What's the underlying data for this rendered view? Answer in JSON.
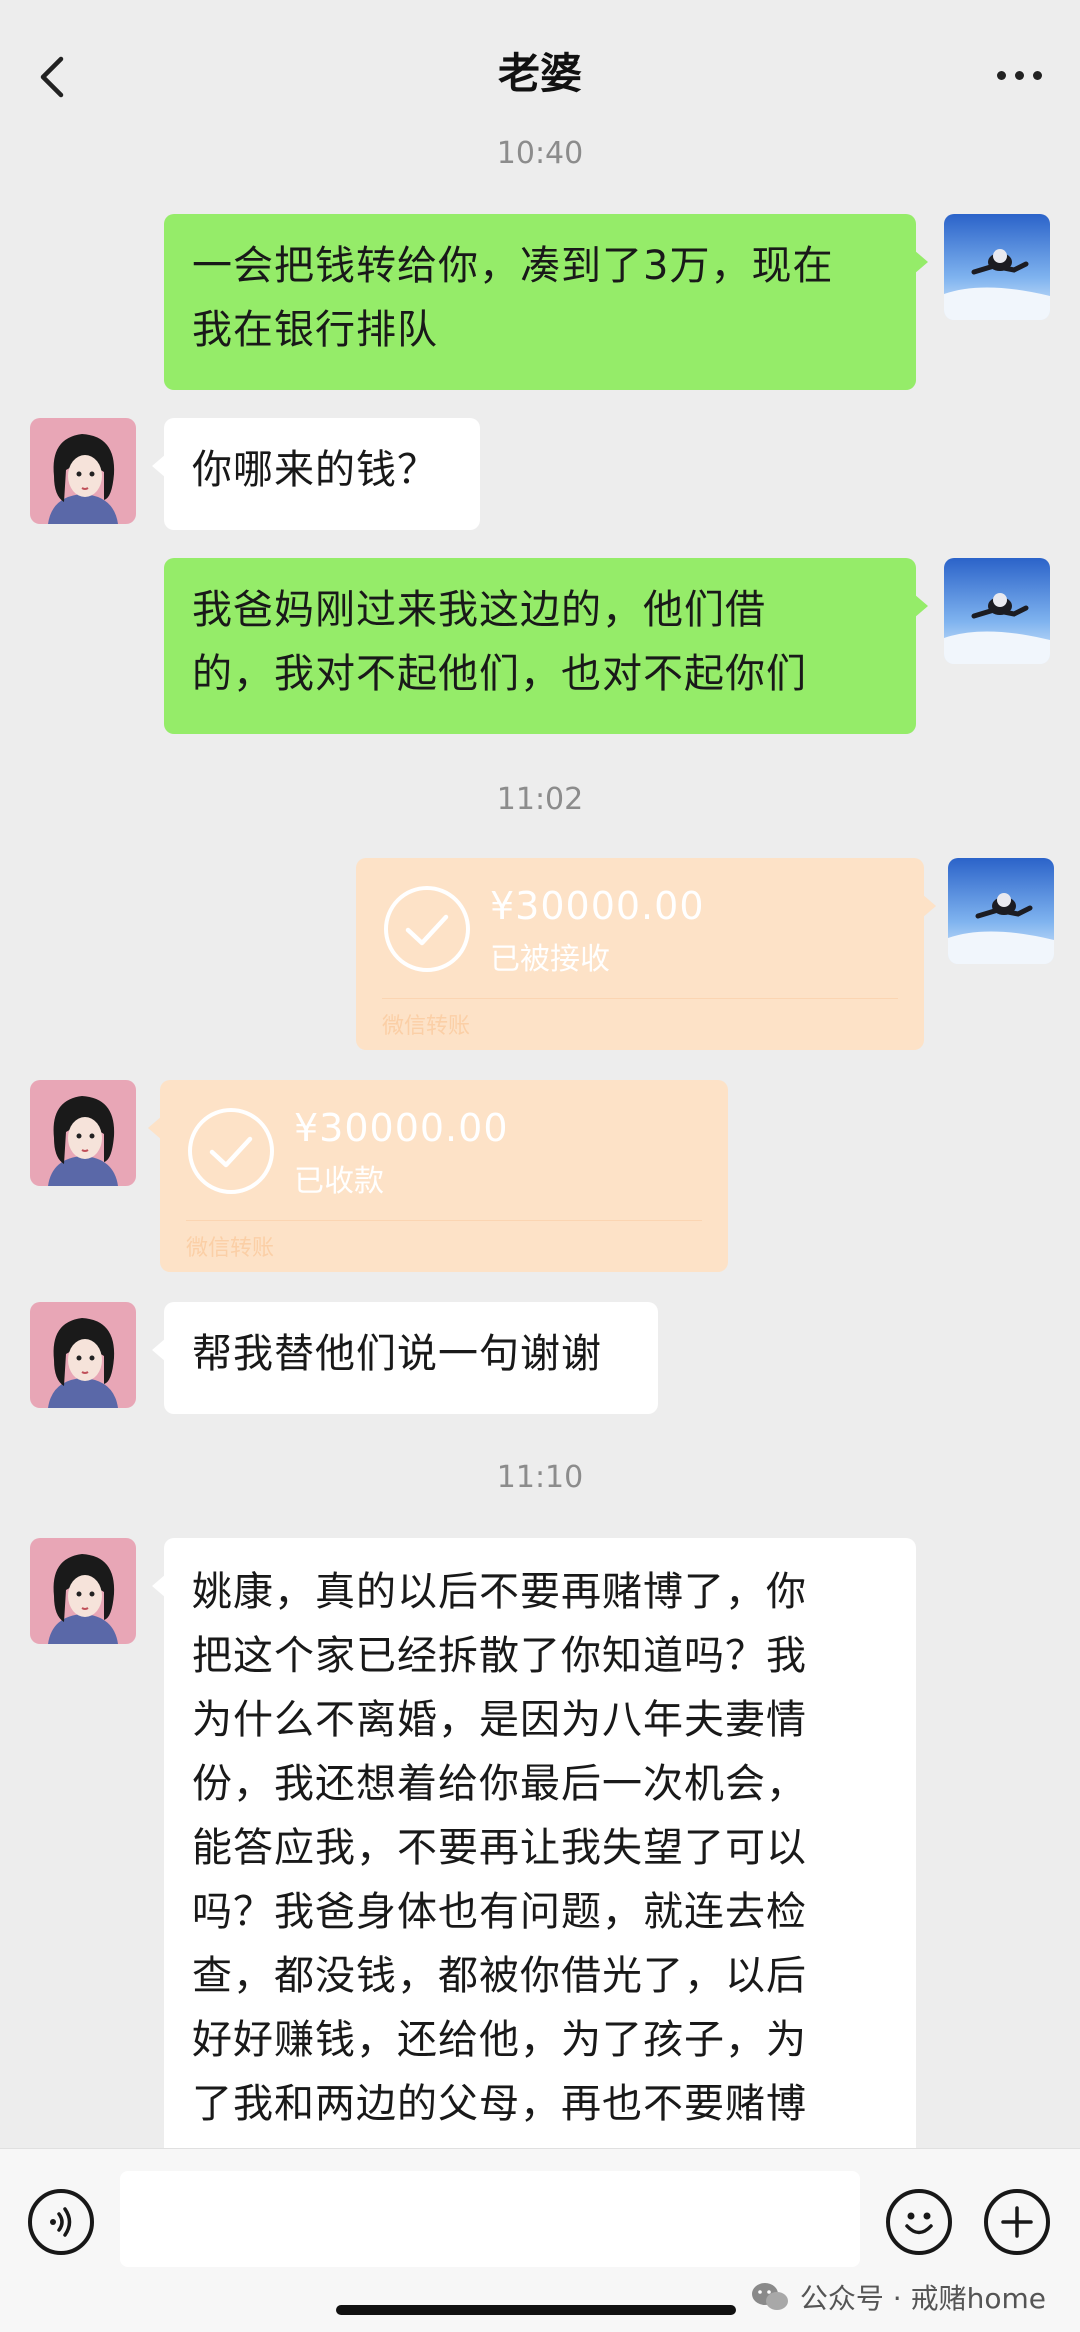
{
  "header": {
    "title": "老婆"
  },
  "messages": {
    "m1": {
      "time": "10:40",
      "text_line1": "一会把钱转给你，凑到了3万，现在",
      "text_line2": "我在银行排队"
    },
    "m2": {
      "text": "你哪来的钱？"
    },
    "m3": {
      "text_line1": "我爸妈刚过来我这边的，他们借",
      "text_line2": "的，我对不起他们，也对不起你们"
    },
    "m4": {
      "time": "11:02",
      "amount": "¥30000.00",
      "status": "已被接收",
      "footer": "微信转账"
    },
    "m5": {
      "amount": "¥30000.00",
      "status": "已收款",
      "footer": "微信转账"
    },
    "m6": {
      "text": "帮我替他们说一句谢谢"
    },
    "m7": {
      "time": "11:10",
      "lines": [
        "姚康，真的以后不要再赌博了，你",
        "把这个家已经拆散了你知道吗？我",
        "为什么不离婚，是因为八年夫妻情",
        "份，我还想着给你最后一次机会，",
        "能答应我，不要再让我失望了可以",
        "吗？我爸身体也有问题，就连去检",
        "查，都没钱，都被你借光了，以后",
        "好好赚钱，还给他，为了孩子，为",
        "了我和两边的父母，再也不要赌博"
      ]
    }
  },
  "input_bar": {
    "watermark": "公众号 · 戒赌home"
  },
  "icons": {
    "back": "chevron-left-icon",
    "more": "more-dots-icon",
    "voice": "voice-icon",
    "emoji": "emoji-icon",
    "plus": "plus-icon"
  },
  "colors": {
    "my_bubble": "#95ec69",
    "their_bubble": "#ffffff",
    "transfer": "#fde2c7",
    "background": "#ededed"
  }
}
